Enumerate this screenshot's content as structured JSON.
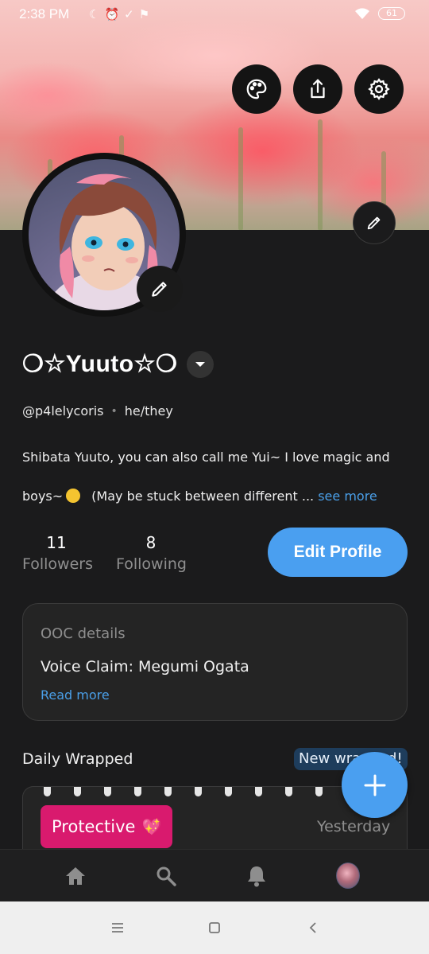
{
  "status_bar": {
    "time": "2:38 PM",
    "battery": "61"
  },
  "profile": {
    "display_name": "❀☆Yuuto☆❀",
    "name_left_decor": "❍☆",
    "name_core": "Yuuto",
    "name_right_decor": "☆❍",
    "handle": "@p4lelycoris",
    "pronouns": "he/they",
    "bio_line1": "Shibata Yuuto, you can also call me Yui~ I love magic and",
    "bio_line2_start": "boys~",
    "bio_line2_end": "(May be stuck between different ...",
    "see_more": "see more"
  },
  "stats": {
    "followers_count": "11",
    "followers_label": "Followers",
    "following_count": "8",
    "following_label": "Following"
  },
  "actions": {
    "edit_profile": "Edit Profile"
  },
  "ooc": {
    "title": "OOC details",
    "text": "Voice Claim: Megumi Ogata",
    "read_more": "Read more"
  },
  "daily_wrapped": {
    "label": "Daily Wrapped",
    "badge": "New wrapped!",
    "tag": "Protective",
    "tag_emoji": "sparkling-heart",
    "date": "Yesterday"
  },
  "icons": {
    "palette": "palette-icon",
    "share": "share-icon",
    "settings": "gear-icon",
    "edit": "pencil-icon",
    "add": "plus-icon",
    "home": "home-icon",
    "search": "search-icon",
    "notifications": "bell-icon"
  },
  "colors": {
    "accent": "#4a9ff0",
    "tag": "#d91a6e",
    "background": "#1b1b1c",
    "card": "#242424"
  }
}
